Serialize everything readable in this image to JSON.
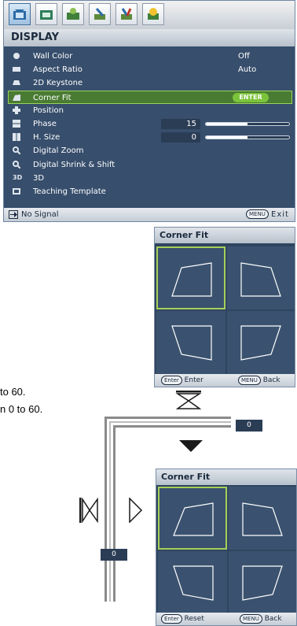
{
  "colors": {
    "osd_bg": "#374e6c",
    "selected": "#4a7b33",
    "accent_green": "#7bc33b",
    "bar": "#d0d7df"
  },
  "osd": {
    "tabs": [
      {
        "icon": "picture-icon",
        "active": true
      },
      {
        "icon": "picture-advanced-icon",
        "active": false
      },
      {
        "icon": "display-icon",
        "active": false
      },
      {
        "icon": "settings-basic-icon",
        "active": false
      },
      {
        "icon": "settings-advanced-icon",
        "active": false
      },
      {
        "icon": "information-icon",
        "active": false
      }
    ],
    "title": "DISPLAY",
    "rows": [
      {
        "label": "Wall Color",
        "value": "Off",
        "icon": "wall-color-icon"
      },
      {
        "label": "Aspect Ratio",
        "value": "Auto",
        "icon": "aspect-ratio-icon"
      },
      {
        "label": "2D Keystone",
        "value": "",
        "icon": "keystone-icon"
      },
      {
        "label": "Corner Fit",
        "value": "",
        "icon": "corner-fit-icon",
        "badge": "ENTER",
        "selected": true
      },
      {
        "label": "Position",
        "value": "",
        "icon": "position-icon"
      },
      {
        "label": "Phase",
        "value": "15",
        "icon": "phase-icon",
        "slider": 0.5
      },
      {
        "label": "H. Size",
        "value": "0",
        "icon": "h-size-icon",
        "slider": 0.5
      },
      {
        "label": "Digital Zoom",
        "value": "",
        "icon": "digital-zoom-icon"
      },
      {
        "label": "Digital Shrink & Shift",
        "value": "",
        "icon": "digital-shrink-icon"
      },
      {
        "label": "3D",
        "value": "",
        "icon": "3d-icon",
        "icon_text": "3D"
      },
      {
        "label": "Teaching Template",
        "value": "",
        "icon": "teaching-template-icon"
      }
    ],
    "status_left": "No Signal",
    "status_key": "MENU",
    "status_right": "Exit"
  },
  "panel1": {
    "title": "Corner Fit",
    "footer": {
      "key1": "Enter",
      "label1": "Enter",
      "key2": "MENU",
      "label2": "Back"
    }
  },
  "panel2": {
    "title": "Corner Fit",
    "footer": {
      "key1": "Enter",
      "label1": "Reset",
      "key2": "MENU",
      "label2": "Back"
    }
  },
  "text_fragments": {
    "line1": "to 60.",
    "line2": "n 0 to 60."
  },
  "adjust": {
    "vertical_value": "0",
    "horizontal_value": "0"
  }
}
